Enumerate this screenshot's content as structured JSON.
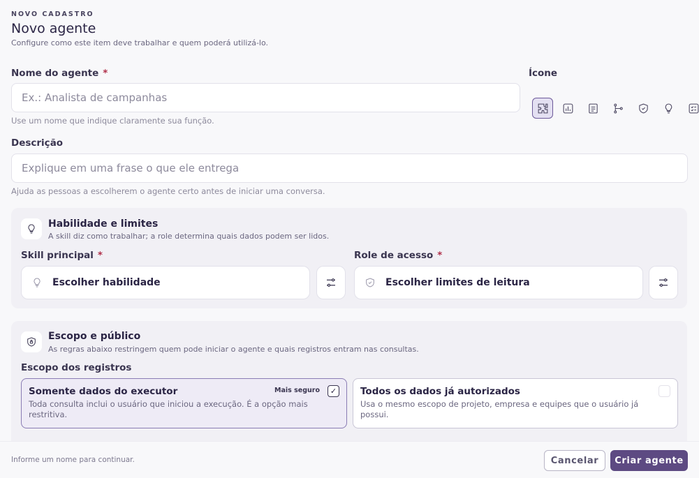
{
  "header": {
    "eyebrow": "NOVO CADASTRO",
    "title": "Novo agente",
    "subtitle": "Configure como este item deve trabalhar e quem poderá utilizá-lo."
  },
  "name_field": {
    "label": "Nome do agente",
    "required_mark": "*",
    "placeholder": "Ex.: Analista de campanhas",
    "hint": "Use um nome que indique claramente sua função."
  },
  "icon_field": {
    "label": "Ícone",
    "icons": [
      "puzzle-icon",
      "chart-icon",
      "document-icon",
      "workflow-icon",
      "shield-check-icon",
      "lightbulb-icon",
      "checklist-icon"
    ],
    "selected": "puzzle-icon"
  },
  "description_field": {
    "label": "Descrição",
    "placeholder": "Explique em uma frase o que ele entrega",
    "hint": "Ajuda as pessoas a escolherem o agente certo antes de iniciar uma conversa."
  },
  "skills_panel": {
    "title": "Habilidade e limites",
    "subtitle": "A skill diz como trabalhar; a role determina quais dados podem ser lidos.",
    "skill": {
      "label": "Skill principal",
      "required_mark": "*",
      "value": "Escolher habilidade"
    },
    "role": {
      "label": "Role de acesso",
      "required_mark": "*",
      "value": "Escolher limites de leitura"
    }
  },
  "scope_panel": {
    "title": "Escopo e público",
    "subtitle": "As regras abaixo restringem quem pode iniciar o agente e quais registros entram nas consultas.",
    "records_label": "Escopo dos registros",
    "options": [
      {
        "title": "Somente dados do executor",
        "badge": "Mais seguro",
        "description": "Toda consulta inclui o usuário que iniciou a execução. É a opção mais restritiva.",
        "selected": true
      },
      {
        "title": "Todos os dados já autorizados",
        "badge": "",
        "description": "Usa o mesmo escopo de projeto, empresa e equipes que o usuário já possui.",
        "selected": false
      }
    ],
    "check_mark": "✓"
  },
  "footer": {
    "hint": "Informe um nome para continuar.",
    "cancel_label": "Cancelar",
    "submit_label": "Criar agente"
  },
  "colors": {
    "primary": "#5d4a82",
    "panel_bg": "#f1f0f5",
    "selected_option_bg": "#eeebf6",
    "required": "#b0304a"
  }
}
